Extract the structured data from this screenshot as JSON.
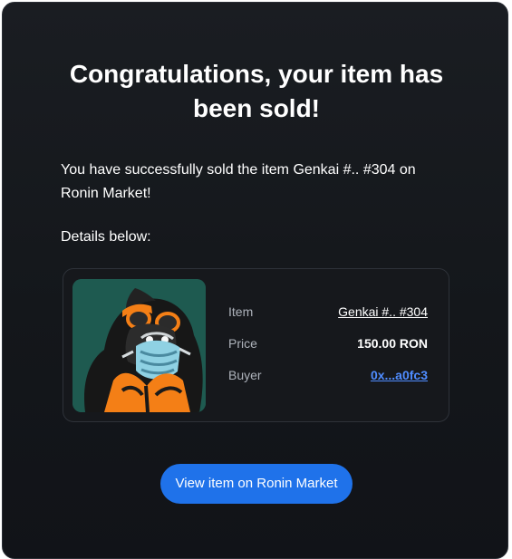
{
  "email": {
    "title": "Congratulations, your item has been sold!",
    "message": "You have successfully sold the item Genkai #.. #304 on Ronin Market!",
    "details_label": "Details below:",
    "details": {
      "item_label": "Item",
      "item_value": "Genkai #.. #304",
      "price_label": "Price",
      "price_value": "150.00 RON",
      "buyer_label": "Buyer",
      "buyer_value": "0x...a0fc3"
    },
    "cta_label": "View item on Ronin Market",
    "image_description": "masked gorilla NFT artwork"
  },
  "colors": {
    "background": "#16181c",
    "accent": "#1f72ea",
    "buyer_link": "#4f8cff"
  }
}
